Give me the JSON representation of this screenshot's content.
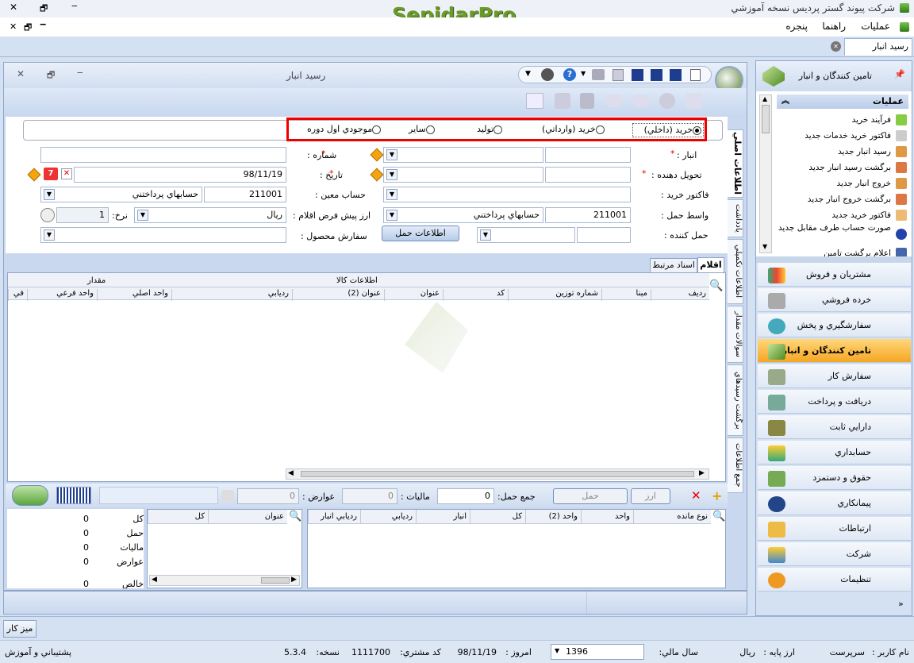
{
  "app": {
    "title": "شرکت پیوند گستر پردیس نسخه آموزشي",
    "brand": "SepidarPro",
    "menu": [
      "عمليات",
      "راهنما",
      "پنجره"
    ]
  },
  "doc_tab": {
    "label": "رسيد انبار"
  },
  "window": {
    "title": "رسيد انبار"
  },
  "radio_options": [
    {
      "label": "خريد (داخلي)",
      "selected": true
    },
    {
      "label": "خريد (وارداتي)",
      "selected": false
    },
    {
      "label": "توليد",
      "selected": false
    },
    {
      "label": "ساير",
      "selected": false
    },
    {
      "label": "موجودي اول دوره",
      "selected": false
    }
  ],
  "form": {
    "warehouse_label": "انبار :",
    "number_label": "شماره :",
    "deliverer_label": "تحويل دهنده :",
    "date_label": "تاريخ :",
    "date_value": "98/11/19",
    "purchase_invoice_label": "فاکتور خريد :",
    "specific_account_label": "حساب معين :",
    "specific_account_code": "211001",
    "specific_account_name": "حسابهاي پرداختني",
    "shipping_intermediary_label": "واسط حمل :",
    "shipping_code": "211001",
    "shipping_name": "حسابهاي پرداختني",
    "default_currency_label": "ارز پيش فرض اقلام :",
    "currency_value": "ريال",
    "rate_label": "نرخ:",
    "rate_value": "1",
    "carrier_label": "حمل کننده :",
    "product_order_label": "سفارش محصول :",
    "shipping_info_button": "اطلاعات حمل"
  },
  "vertical_tabs": [
    "اطلاعات اصلي",
    "يادداشت",
    "اطلاعات تکميلي",
    "سوالات مقدار",
    "برگشت رسيدهاي",
    "جمع اطلاعات"
  ],
  "grid_tabs": [
    "اقلام",
    "اسناد مرتبط"
  ],
  "grid": {
    "group_headers": {
      "item_info": "اطلاعات کالا",
      "quantity": "مقدار"
    },
    "columns": [
      "رديف",
      "مبنا",
      "شماره توزين",
      "کد",
      "عنوان",
      "عنوان (2)",
      "رديابي",
      "واحد اصلي",
      "واحد فرعي",
      "في"
    ]
  },
  "footer_bar": {
    "currency_button": "ارز",
    "shipping_button": "حمل",
    "shipping_total_label": "جمع حمل:",
    "shipping_total_value": "0",
    "tax_label": "ماليات :",
    "tax_value": "0",
    "duties_label": "عوارض :",
    "duties_value": "0"
  },
  "lower_grid": {
    "columns": [
      "نوع مانده",
      "واحد",
      "واحد (2)",
      "کل",
      "انبار",
      "رديابي",
      "رديابي انبار"
    ]
  },
  "mid_grid": {
    "columns": [
      "عنوان",
      "کل"
    ]
  },
  "totals": [
    {
      "label": "کل",
      "value": "0"
    },
    {
      "label": "حمل",
      "value": "0"
    },
    {
      "label": "ماليات",
      "value": "0"
    },
    {
      "label": "عوارض",
      "value": "0"
    },
    {
      "label": "خالص",
      "value": "0"
    }
  ],
  "right_panel": {
    "header": "تامين کنندگان و انبار",
    "ops_title": "عمليات",
    "ops": [
      "فرآيند خريد",
      "فاکتور خريد خدمات جديد",
      "رسيد انبار جديد",
      "برگشت رسيد انبار جديد",
      "خروج انبار جديد",
      "برگشت خروج انبار جديد",
      "فاکتور خريد جديد",
      "صورت حساب طرف مقابل جديد",
      "اعلام برگشت تامين"
    ],
    "modules": [
      "مشتريان و فروش",
      "خرده فروشي",
      "سفارشگيري و پخش",
      "تامين کنندگان و انبار",
      "سفارش کار",
      "دريافت و پرداخت",
      "دارايي ثابت",
      "حسابداري",
      "حقوق و دستمزد",
      "پيمانکاري",
      "ارتباطات",
      "شرکت",
      "تنظيمات"
    ],
    "active_module": 3
  },
  "desk_button": "ميز کار",
  "status": {
    "username_label": "نام کاربر :",
    "username": "سرپرست",
    "base_currency_label": "ارز پايه :",
    "base_currency": "ريال",
    "fiscal_year_label": "سال مالي:",
    "fiscal_year": "1396",
    "today_label": "امروز :",
    "today": "98/11/19",
    "customer_code_label": "کد مشتري:",
    "customer_code": "1111700",
    "version_label": "نسخه:",
    "version": "5.3.4",
    "support": "پشتيباني و آموزش"
  }
}
